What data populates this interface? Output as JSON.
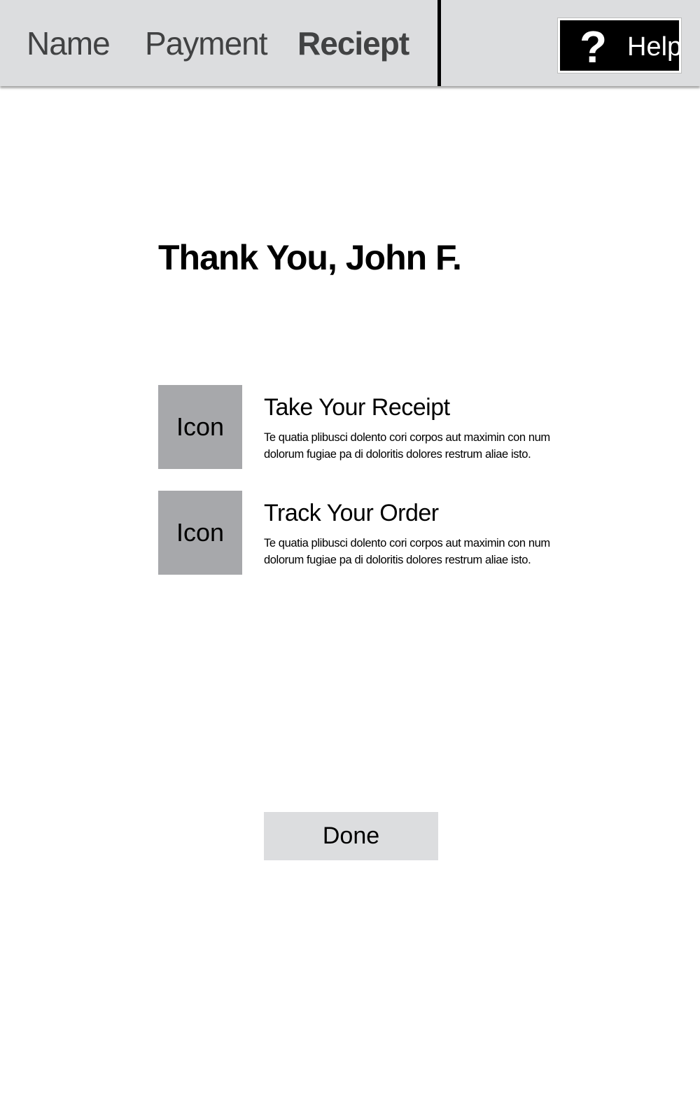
{
  "steps": {
    "name": "Name",
    "payment": "Payment",
    "receipt": "Reciept"
  },
  "help": {
    "icon_glyph": "?",
    "label": "Help"
  },
  "greeting": "Thank You, John F.",
  "items": [
    {
      "icon_label": "Icon",
      "title": "Take Your Receipt",
      "description": "Te quatia plibusci dolento cori corpos aut maximin con num dolorum fugiae pa di doloritis dolores restrum aliae isto."
    },
    {
      "icon_label": "Icon",
      "title": "Track Your Order",
      "description": "Te quatia plibusci dolento cori corpos aut maximin con num dolorum fugiae pa di doloritis dolores restrum aliae isto."
    }
  ],
  "done_label": "Done",
  "colors": {
    "bar_background": "#dcdddf",
    "icon_placeholder": "#a7a8ab",
    "help_background": "#000000",
    "step_text": "#414243"
  }
}
